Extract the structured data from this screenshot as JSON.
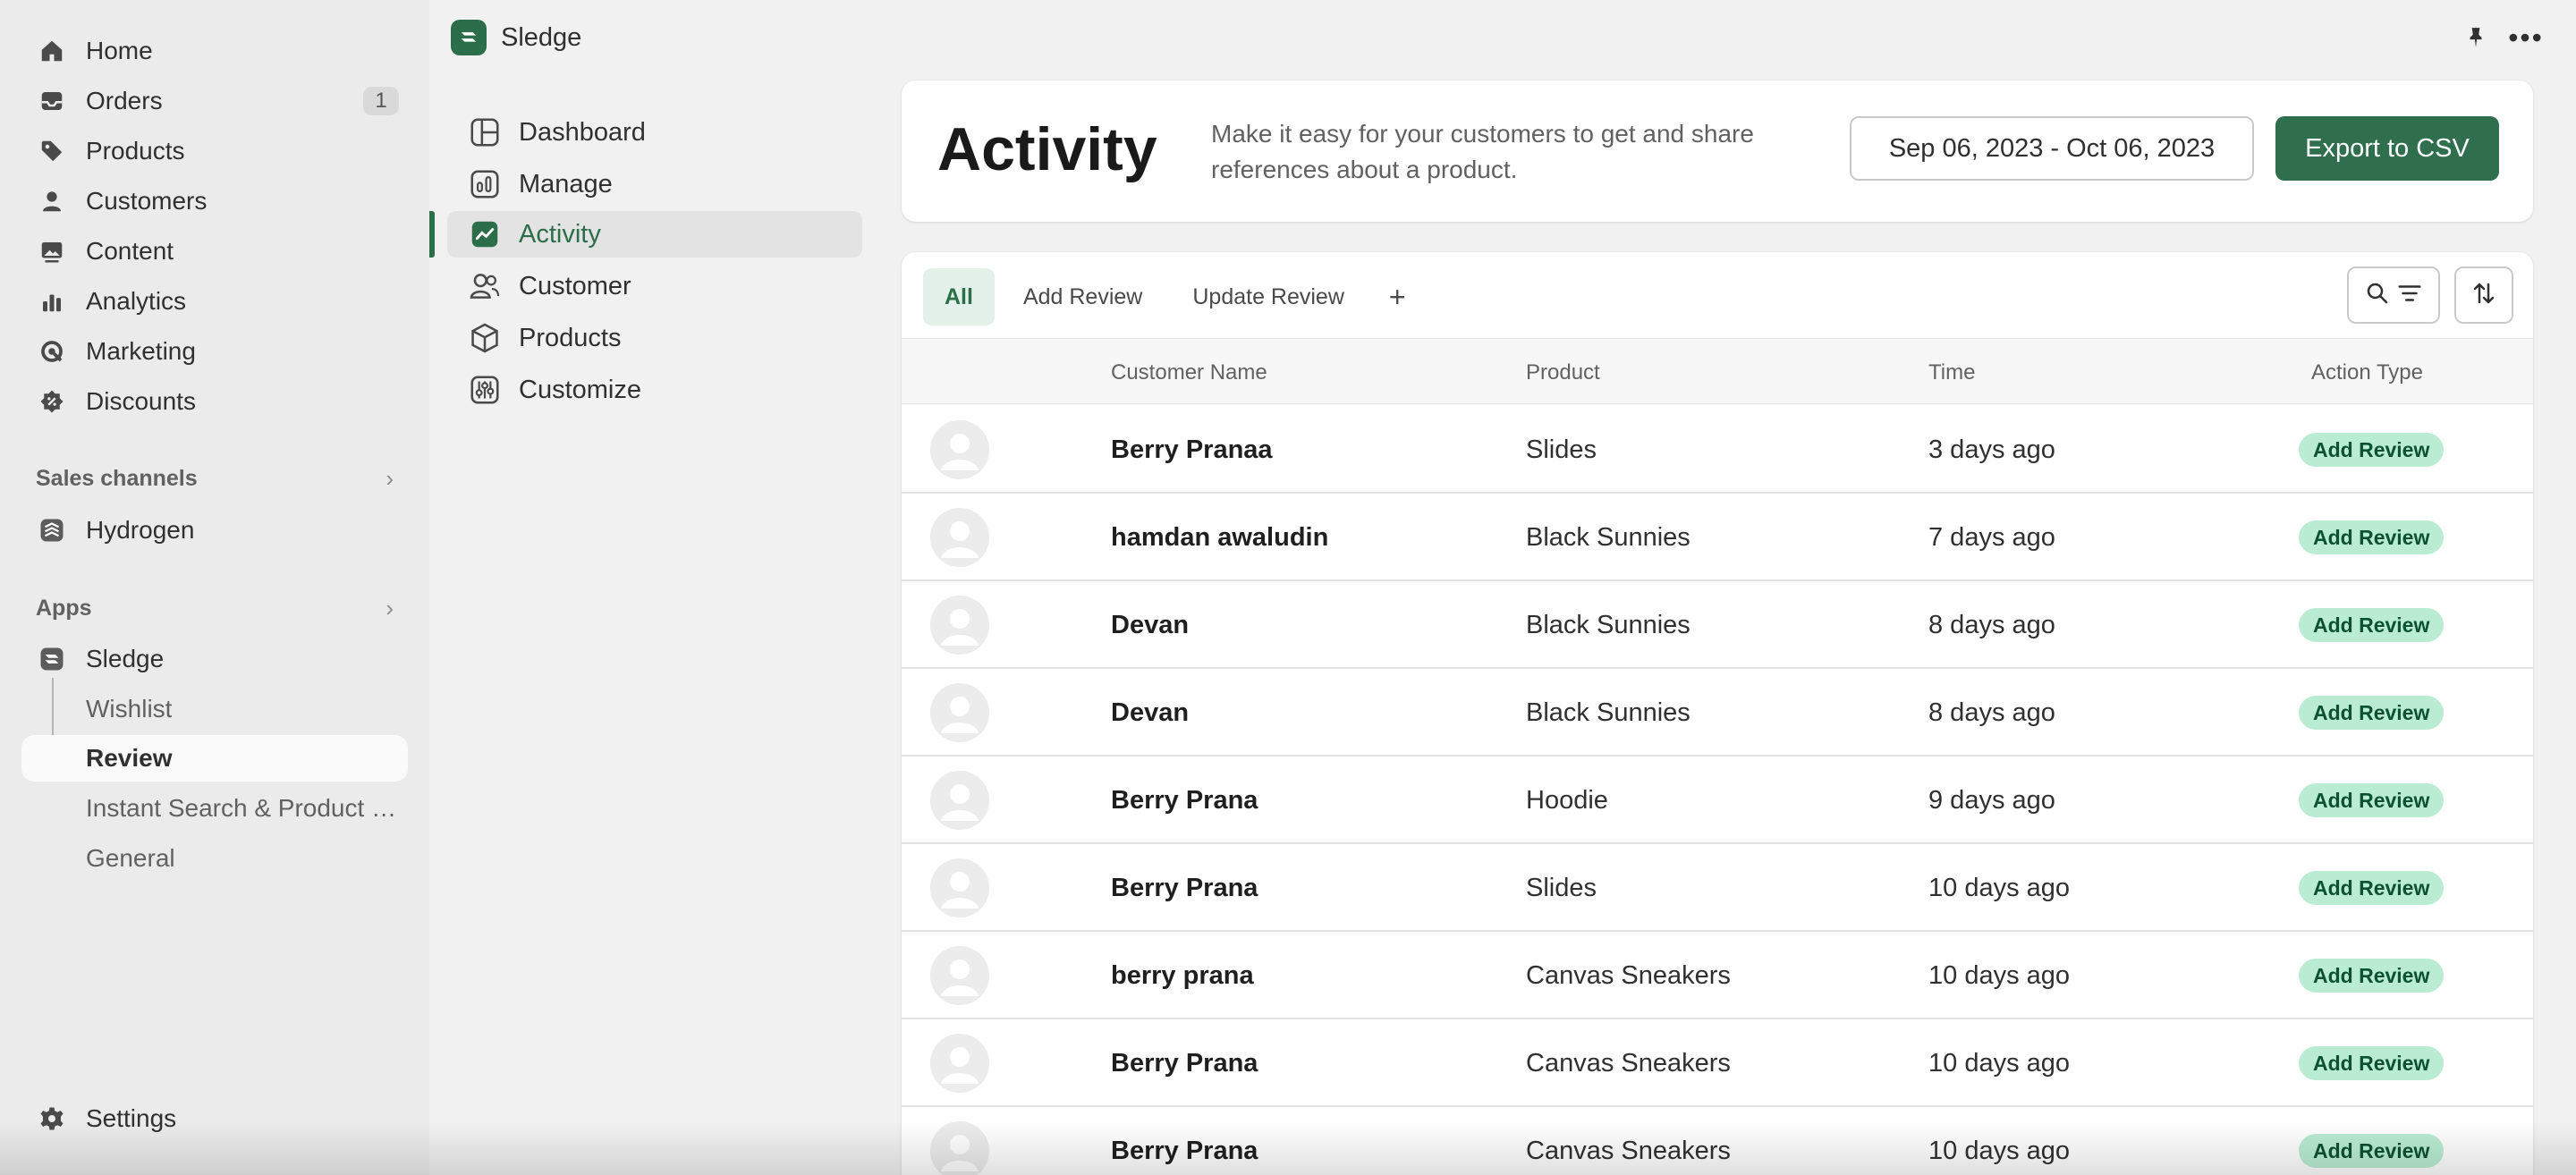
{
  "admin_nav": {
    "items": [
      {
        "label": "Home",
        "icon": "home-icon"
      },
      {
        "label": "Orders",
        "icon": "inbox-icon",
        "count": "1"
      },
      {
        "label": "Products",
        "icon": "tag-icon"
      },
      {
        "label": "Customers",
        "icon": "person-icon"
      },
      {
        "label": "Content",
        "icon": "image-icon"
      },
      {
        "label": "Analytics",
        "icon": "bar-chart-icon"
      },
      {
        "label": "Marketing",
        "icon": "target-icon"
      },
      {
        "label": "Discounts",
        "icon": "discount-icon"
      }
    ],
    "sales_channels": {
      "title": "Sales channels",
      "items": [
        {
          "label": "Hydrogen"
        }
      ]
    },
    "apps": {
      "title": "Apps",
      "app_name": "Sledge",
      "sub_items": [
        "Wishlist",
        "Review",
        "Instant Search & Product Filter",
        "General"
      ],
      "active_sub": "Review"
    },
    "settings_label": "Settings"
  },
  "app_header": {
    "title": "Sledge"
  },
  "app_nav": {
    "items": [
      {
        "label": "Dashboard",
        "icon": "layout-icon"
      },
      {
        "label": "Manage",
        "icon": "chart-icon"
      },
      {
        "label": "Activity",
        "icon": "trend-icon"
      },
      {
        "label": "Customer",
        "icon": "people-icon"
      },
      {
        "label": "Products",
        "icon": "cube-icon"
      },
      {
        "label": "Customize",
        "icon": "sliders-icon"
      }
    ],
    "active": "Activity"
  },
  "page": {
    "title": "Activity",
    "description": "Make it easy for your customers to get and share references about a product.",
    "date_range": "Sep 06, 2023 - Oct 06, 2023",
    "export_label": "Export to CSV"
  },
  "tabs": [
    "All",
    "Add Review",
    "Update Review",
    "+"
  ],
  "active_tab": "All",
  "table": {
    "columns": [
      "Customer Name",
      "Product",
      "Time",
      "Action Type"
    ],
    "rows": [
      {
        "name": "Berry Pranaa",
        "product": "Slides",
        "time": "3 days ago",
        "action": "Add Review"
      },
      {
        "name": "hamdan awaludin",
        "product": "Black Sunnies",
        "time": "7 days ago",
        "action": "Add Review"
      },
      {
        "name": "Devan",
        "product": "Black Sunnies",
        "time": "8 days ago",
        "action": "Add Review"
      },
      {
        "name": "Devan",
        "product": "Black Sunnies",
        "time": "8 days ago",
        "action": "Add Review"
      },
      {
        "name": "Berry Prana",
        "product": "Hoodie",
        "time": "9 days ago",
        "action": "Add Review"
      },
      {
        "name": "Berry Prana",
        "product": "Slides",
        "time": "10 days ago",
        "action": "Add Review"
      },
      {
        "name": "berry prana",
        "product": "Canvas Sneakers",
        "time": "10 days ago",
        "action": "Add Review"
      },
      {
        "name": "Berry Prana",
        "product": "Canvas Sneakers",
        "time": "10 days ago",
        "action": "Add Review"
      },
      {
        "name": "Berry Prana",
        "product": "Canvas Sneakers",
        "time": "10 days ago",
        "action": "Add Review"
      }
    ]
  },
  "colors": {
    "brand": "#2c6e49",
    "badge_bg": "#b9ecd2",
    "badge_text": "#0c5132"
  }
}
